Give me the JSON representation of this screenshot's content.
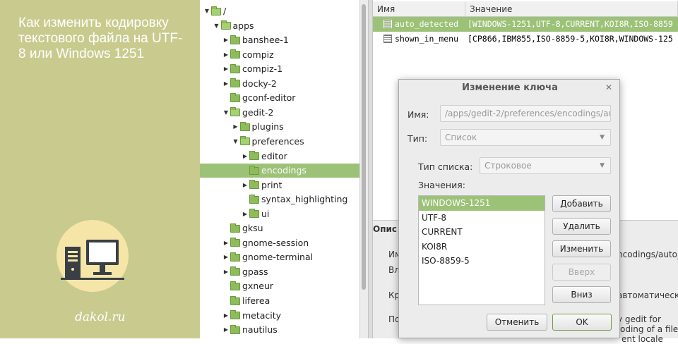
{
  "promo": {
    "title": "Как изменить кодировку текстового файла на UTF-8 или Windows 1251",
    "site": "dakol.ru"
  },
  "tree": {
    "items": [
      {
        "label": "/",
        "depth": 0,
        "arrow": "down",
        "selected": false
      },
      {
        "label": "apps",
        "depth": 1,
        "arrow": "down",
        "selected": false
      },
      {
        "label": "banshee-1",
        "depth": 2,
        "arrow": "right",
        "selected": false
      },
      {
        "label": "compiz",
        "depth": 2,
        "arrow": "right",
        "selected": false
      },
      {
        "label": "compiz-1",
        "depth": 2,
        "arrow": "right",
        "selected": false
      },
      {
        "label": "docky-2",
        "depth": 2,
        "arrow": "right",
        "selected": false
      },
      {
        "label": "gconf-editor",
        "depth": 2,
        "arrow": "none",
        "selected": false
      },
      {
        "label": "gedit-2",
        "depth": 2,
        "arrow": "down",
        "selected": false
      },
      {
        "label": "plugins",
        "depth": 3,
        "arrow": "right",
        "selected": false
      },
      {
        "label": "preferences",
        "depth": 3,
        "arrow": "down",
        "selected": false
      },
      {
        "label": "editor",
        "depth": 4,
        "arrow": "right",
        "selected": false
      },
      {
        "label": "encodings",
        "depth": 4,
        "arrow": "none",
        "selected": true
      },
      {
        "label": "print",
        "depth": 4,
        "arrow": "right",
        "selected": false
      },
      {
        "label": "syntax_highlighting",
        "depth": 4,
        "arrow": "none",
        "selected": false
      },
      {
        "label": "ui",
        "depth": 4,
        "arrow": "right",
        "selected": false
      },
      {
        "label": "gksu",
        "depth": 2,
        "arrow": "none",
        "selected": false
      },
      {
        "label": "gnome-session",
        "depth": 2,
        "arrow": "right",
        "selected": false
      },
      {
        "label": "gnome-terminal",
        "depth": 2,
        "arrow": "right",
        "selected": false
      },
      {
        "label": "gpass",
        "depth": 2,
        "arrow": "right",
        "selected": false
      },
      {
        "label": "gxneur",
        "depth": 2,
        "arrow": "none",
        "selected": false
      },
      {
        "label": "liferea",
        "depth": 2,
        "arrow": "none",
        "selected": false
      },
      {
        "label": "metacity",
        "depth": 2,
        "arrow": "right",
        "selected": false
      },
      {
        "label": "nautilus",
        "depth": 2,
        "arrow": "right",
        "selected": false
      }
    ]
  },
  "keys": {
    "col_name": "Имя",
    "col_value": "Значение",
    "rows": [
      {
        "name": "auto_detected",
        "value": "[WINDOWS-1251,UTF-8,CURRENT,KOI8R,ISO-8859",
        "selected": true
      },
      {
        "name": "shown_in_menu",
        "value": "[CP866,IBM855,ISO-8859-5,KOI8R,WINDOWS-125",
        "selected": false
      }
    ]
  },
  "description": {
    "heading": "Опис",
    "line1_prefix": "Им",
    "line1_suffix": "ncodings/auto_detec",
    "line2_prefix": "Вл",
    "line3_prefix": "Кр",
    "line3_suffix": "автоматически",
    "line4_prefix": "По",
    "line4_suffix": "y gedit for",
    "line5_suffix": "oding of a file",
    "line6_suffix": "ent locale"
  },
  "dialog": {
    "title": "Изменение ключа",
    "name_label": "Имя:",
    "name_value": "/apps/gedit-2/preferences/encodings/au",
    "type_label": "Тип:",
    "type_value": "Список",
    "list_type_label": "Тип списка:",
    "list_type_value": "Строковое",
    "values_label": "Значения:",
    "values": [
      "WINDOWS-1251",
      "UTF-8",
      "CURRENT",
      "KOI8R",
      "ISO-8859-5"
    ],
    "selected_index": 0,
    "buttons": {
      "add": "Добавить",
      "remove": "Удалить",
      "edit": "Изменить",
      "up": "Вверх",
      "down": "Вниз",
      "cancel": "Отменить",
      "ok": "OK"
    }
  },
  "colors": {
    "accent": "#9cc277",
    "promo_bg": "#c9cb8e"
  }
}
